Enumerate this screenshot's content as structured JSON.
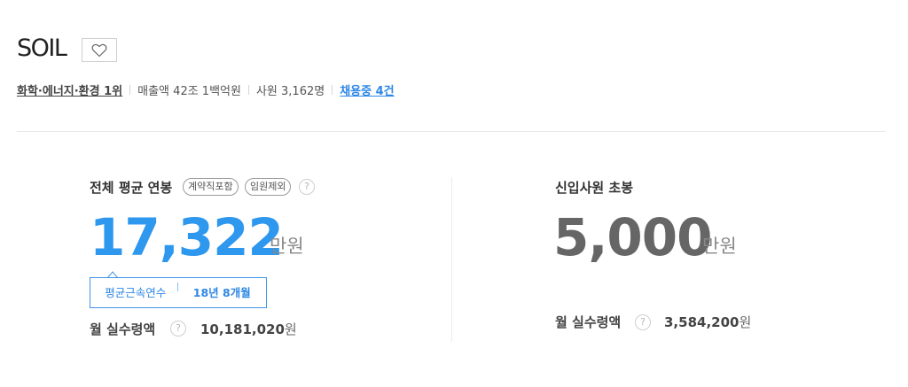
{
  "company": {
    "name": "SOIL",
    "favorite_icon": "heart-outline-icon"
  },
  "info": {
    "industry": "화학·에너지·환경 1위",
    "revenue_label": "매출액",
    "revenue_value": "42조 1백억원",
    "employees_label": "사원",
    "employees_value": "3,162명",
    "hiring": "채용중 4건"
  },
  "salary": {
    "title": "전체 평균 연봉",
    "chips": [
      "계약직포함",
      "임원제외"
    ],
    "help_icon": "question-icon",
    "value": "17,322",
    "unit": "만원",
    "tenure_label": "평균근속연수",
    "tenure_value": "18년 8개월",
    "monthly_label": "월 실수령액",
    "monthly_value": "10,181,020",
    "monthly_unit": "원"
  },
  "starting": {
    "title": "신입사원 초봉",
    "value": "5,000",
    "unit": "만원",
    "monthly_label": "월 실수령액",
    "monthly_value": "3,584,200",
    "monthly_unit": "원"
  },
  "colors": {
    "accent_blue": "#2e97ee",
    "dark_gray_number": "#666666",
    "link_blue": "#2e87e6"
  }
}
